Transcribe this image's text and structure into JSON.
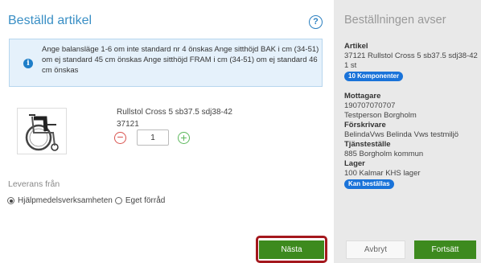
{
  "main": {
    "title": "Beställd artikel",
    "help_icon": "question-circle-icon",
    "info": {
      "icon": "info-circle-icon",
      "text": "Ange balansläge 1-6 om inte standard nr 4 önskas Ange sitthöjd BAK i cm (34-51) om ej standard 45 cm önskas Ange sitthöjd FRAM i cm (34-51) om ej standard 46 cm önskas"
    },
    "product": {
      "image_icon": "wheelchair-image",
      "name": "Rullstol Cross 5 sb37.5 sdj38-42",
      "number": "37121",
      "quantity": "1",
      "minus_icon": "minus-circle-icon",
      "plus_icon": "plus-circle-icon"
    },
    "delivery": {
      "label": "Leverans från",
      "options": [
        {
          "label": "Hjälpmedelsverksamheten",
          "checked": true
        },
        {
          "label": "Eget förråd",
          "checked": false
        }
      ]
    },
    "next_label": "Nästa"
  },
  "summary": {
    "title": "Beställningen avser",
    "article_label": "Artikel",
    "article_value": "37121 Rullstol Cross 5 sb37.5 sdj38-42",
    "quantity": "1 st",
    "components_badge": "10 Komponenter",
    "receiver_label": "Mottagare",
    "receiver_id": "190707070707",
    "receiver_name": "Testperson Borgholm",
    "prescriber_label": "Förskrivare",
    "prescriber_value": "BelindaVws Belinda Vws testmiljö",
    "service_label": "Tjänsteställe",
    "service_value": "885 Borgholm kommun",
    "storage_label": "Lager",
    "storage_value": "100 Kalmar KHS lager",
    "orderable_badge": "Kan beställas",
    "cancel_label": "Avbryt",
    "continue_label": "Fortsätt"
  },
  "colors": {
    "accent": "#3a8fc5",
    "primary_button": "#3d8a1e",
    "badge": "#1a73d9",
    "highlight_outline": "#a4181d"
  }
}
